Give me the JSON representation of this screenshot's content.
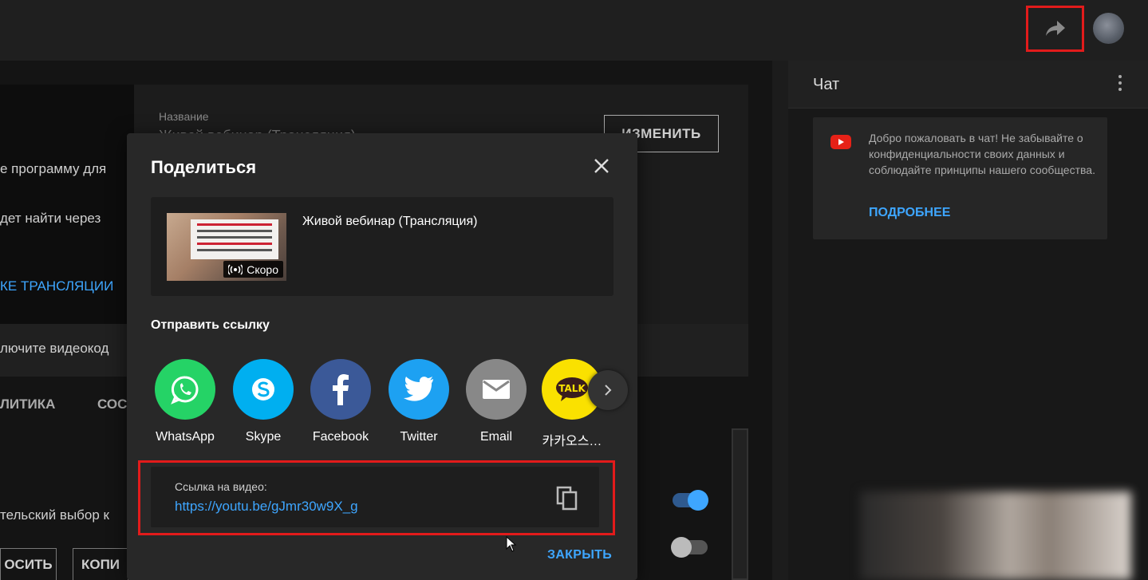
{
  "background": {
    "left_texts": [
      "е программу для",
      "дет найти через",
      "лючите видеокод",
      "тельский выбор к"
    ],
    "left_link": "КЕ ТРАНСЛЯЦИИ",
    "tabs": [
      "ЛИТИКА",
      "СОСТ"
    ],
    "field_label": "Название",
    "field_value": "Живой вебинар (Трансляция)",
    "edit_button": "ИЗМЕНИТЬ",
    "bottom_buttons": [
      "ОСИТЬ",
      "КОПИ"
    ]
  },
  "chat": {
    "title": "Чат",
    "welcome_text": "Добро пожаловать в чат! Не забывайте о конфиденциальности своих данных и соблюдайте принципы нашего сообщества.",
    "more_link": "ПОДРОБНЕЕ"
  },
  "modal": {
    "title": "Поделиться",
    "video_title": "Живой вебинар (Трансляция)",
    "badge": "Скоро",
    "send_link_label": "Отправить ссылку",
    "share_targets": [
      {
        "label": "WhatsApp",
        "icon": "whatsapp-icon",
        "color": "#25d366"
      },
      {
        "label": "Skype",
        "icon": "skype-icon",
        "color": "#00aff0"
      },
      {
        "label": "Facebook",
        "icon": "facebook-icon",
        "color": "#3b5998"
      },
      {
        "label": "Twitter",
        "icon": "twitter-icon",
        "color": "#1da1f2"
      },
      {
        "label": "Email",
        "icon": "email-icon",
        "color": "#888888"
      },
      {
        "label": "카카오스…",
        "icon": "kakaotalk-icon",
        "color": "#fae100"
      }
    ],
    "link_label": "Ссылка на видео:",
    "link_url": "https://youtu.be/gJmr30w9X_g",
    "close_button": "ЗАКРЫТЬ"
  },
  "colors": {
    "accent_link": "#3ea6ff",
    "highlight_red": "#e21b1b",
    "modal_bg": "#282828"
  }
}
